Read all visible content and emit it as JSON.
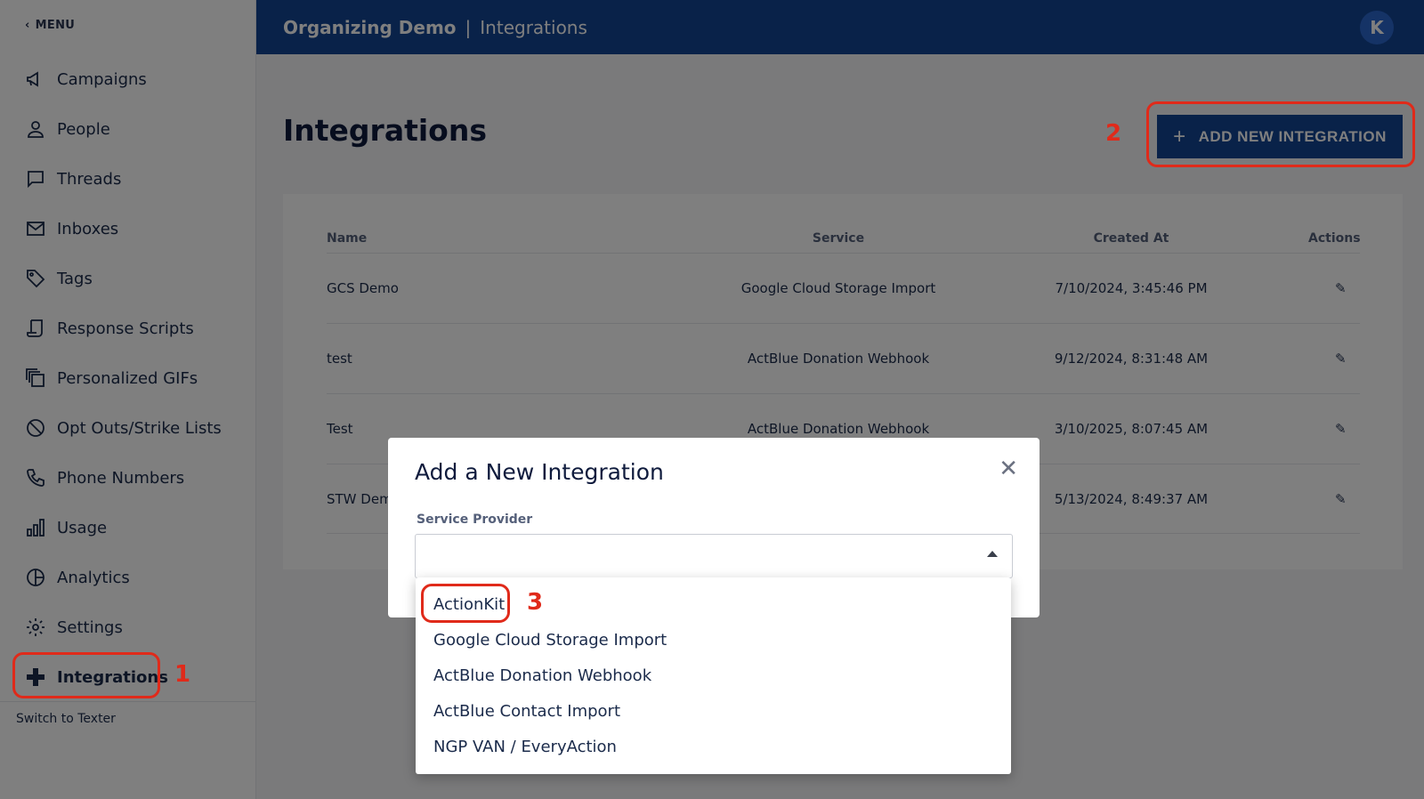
{
  "sidebar": {
    "menu_label": "MENU",
    "items": [
      {
        "label": "Campaigns",
        "icon": "megaphone-icon"
      },
      {
        "label": "People",
        "icon": "person-icon"
      },
      {
        "label": "Threads",
        "icon": "chat-icon"
      },
      {
        "label": "Inboxes",
        "icon": "mail-icon"
      },
      {
        "label": "Tags",
        "icon": "tag-icon"
      },
      {
        "label": "Response Scripts",
        "icon": "script-icon"
      },
      {
        "label": "Personalized GIFs",
        "icon": "gifs-icon"
      },
      {
        "label": "Opt Outs/Strike Lists",
        "icon": "block-icon"
      },
      {
        "label": "Phone Numbers",
        "icon": "phone-icon"
      },
      {
        "label": "Usage",
        "icon": "bar-chart-icon"
      },
      {
        "label": "Analytics",
        "icon": "pie-chart-icon"
      },
      {
        "label": "Settings",
        "icon": "gear-icon"
      },
      {
        "label": "Integrations",
        "icon": "plus-icon",
        "active": true
      }
    ],
    "switch_label": "Switch to Texter"
  },
  "header": {
    "org": "Organizing Demo",
    "separator": "|",
    "section": "Integrations",
    "avatar_initial": "K"
  },
  "main": {
    "title": "Integrations",
    "add_button_label": "ADD NEW INTEGRATION",
    "table": {
      "columns": [
        "Name",
        "Service",
        "Created At",
        "Actions"
      ],
      "rows": [
        {
          "name": "GCS Demo",
          "service": "Google Cloud Storage Import",
          "created": "7/10/2024, 3:45:46 PM"
        },
        {
          "name": "test",
          "service": "ActBlue Donation Webhook",
          "created": "9/12/2024, 8:31:48 AM"
        },
        {
          "name": "Test",
          "service": "ActBlue Donation Webhook",
          "created": "3/10/2025, 8:07:45 AM"
        },
        {
          "name": "STW Dem",
          "service": "",
          "created": "5/13/2024, 8:49:37 AM"
        }
      ]
    }
  },
  "dialog": {
    "title": "Add a New Integration",
    "field_label": "Service Provider",
    "options": [
      "ActionKit",
      "Google Cloud Storage Import",
      "ActBlue Donation Webhook",
      "ActBlue Contact Import",
      "NGP VAN / EveryAction"
    ]
  },
  "annotations": {
    "step1": "1",
    "step2": "2",
    "step3": "3"
  },
  "colors": {
    "header": "#134492",
    "accent": "#134492",
    "annotation": "#e02a1a"
  }
}
